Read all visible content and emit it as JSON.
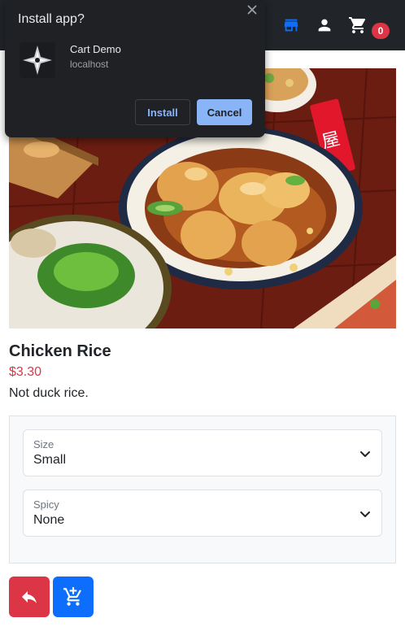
{
  "navbar": {
    "store_icon": "storefront-icon",
    "user_icon": "person-icon",
    "cart_icon": "shopping-cart-icon",
    "cart_count": "0",
    "colors": {
      "background": "#212529",
      "store_icon": "#0d6efd",
      "badge": "#dc3545"
    }
  },
  "install_popup": {
    "title": "Install app?",
    "app_name": "Cart Demo",
    "app_host": "localhost",
    "install_label": "Install",
    "cancel_label": "Cancel",
    "close_icon": "close-icon",
    "colors": {
      "background": "#202124",
      "accent": "#8ab4f8"
    }
  },
  "product": {
    "image_alt": "chicken-rice-illustration",
    "name": "Chicken Rice",
    "price": "$3.30",
    "description": "Not duck rice.",
    "colors": {
      "price": "#dc3545"
    }
  },
  "options": {
    "size": {
      "label": "Size",
      "value": "Small"
    },
    "spicy": {
      "label": "Spicy",
      "value": "None"
    }
  },
  "actions": {
    "back_icon": "reply-arrow-icon",
    "add_icon": "add-to-cart-icon",
    "colors": {
      "back": "#dc3545",
      "add": "#0d6efd"
    }
  }
}
